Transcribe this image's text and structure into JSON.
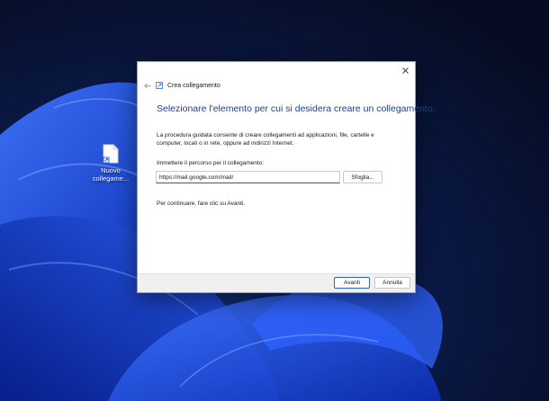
{
  "desktop": {
    "shortcut": {
      "label": "Nuovo collegame...",
      "icon": "file-icon"
    }
  },
  "dialog": {
    "close_glyph": "✕",
    "back_glyph": "←",
    "wizard_title": "Crea collegamento",
    "heading": "Selezionare l'elemento per cui si desidera creare un collegamento.",
    "description": "La procedura guidata consente di creare collegamenti ad applicazioni, file, cartelle e computer, locali o in rete, oppure ad indirizzi Internet.",
    "path_label": "Immettere il percorso per il collegamento:",
    "path_value": "https://mail.google.com/mail/",
    "browse_label": "Sfoglia...",
    "continue_text": "Per continuare, fare clic su Avanti.",
    "next_label": "Avanti",
    "cancel_label": "Annulla"
  },
  "colors": {
    "heading": "#1e3d8f",
    "accent": "#1f5fb4",
    "wallpaper_dark": "#0a1430",
    "wallpaper_bloom": "#1b49e0"
  }
}
